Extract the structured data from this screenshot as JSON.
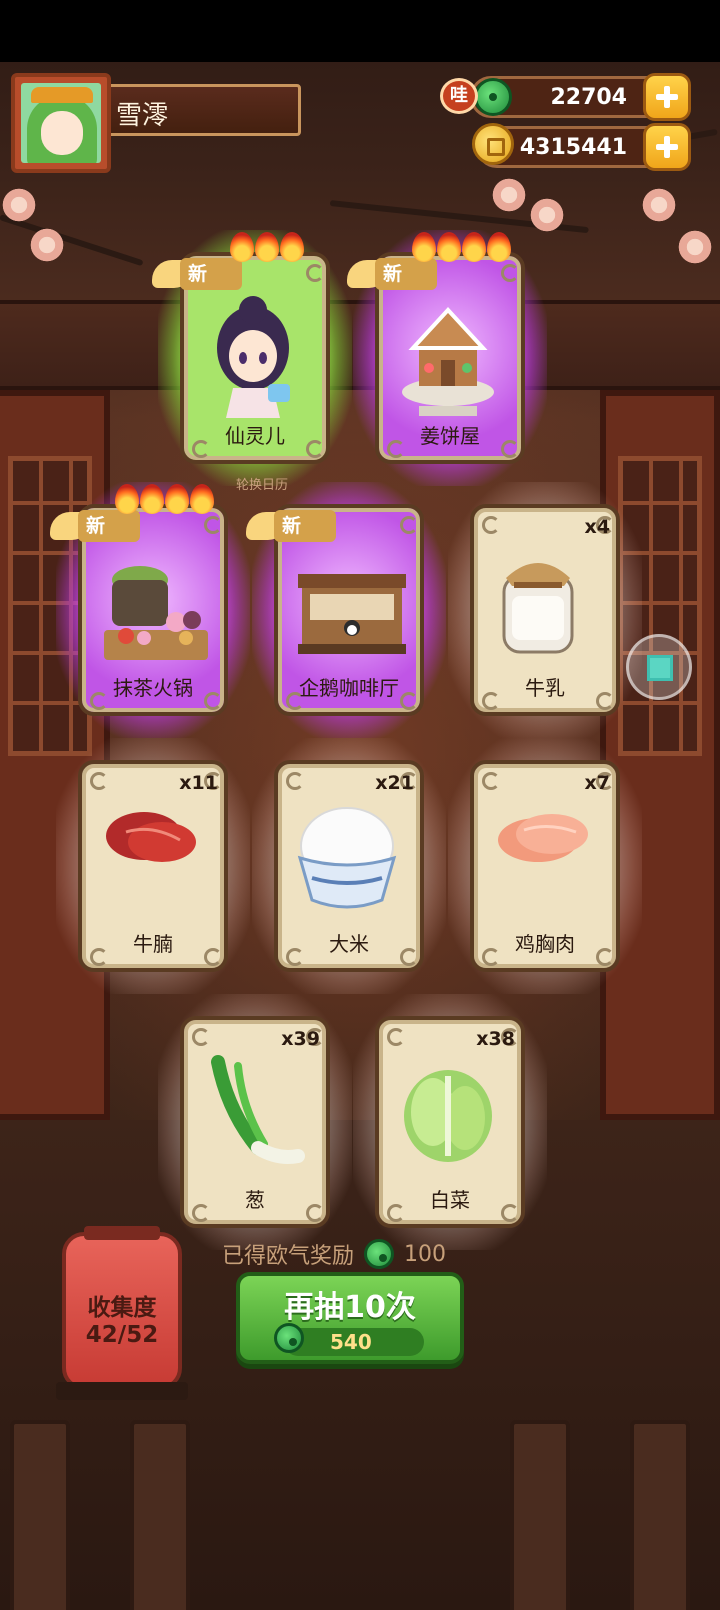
{
  "player": {
    "name": "雪澪"
  },
  "currencies": {
    "jade": "22704",
    "coins": "4315441",
    "badge": "哇"
  },
  "rotate_calendar": "轮换日历",
  "new_tag": "新",
  "cards": [
    {
      "id": "xianlinger",
      "label": "仙灵儿",
      "rarity": "green",
      "is_new": true,
      "flames": 3,
      "count": ""
    },
    {
      "id": "jiangbingwu",
      "label": "姜饼屋",
      "rarity": "purple",
      "is_new": true,
      "flames": 4,
      "count": ""
    },
    {
      "id": "mochahotpot",
      "label": "抹茶火锅",
      "rarity": "purple",
      "is_new": true,
      "flames": 4,
      "count": ""
    },
    {
      "id": "penguincafe",
      "label": "企鹅咖啡厅",
      "rarity": "purple",
      "is_new": true,
      "flames": 0,
      "count": ""
    },
    {
      "id": "milk",
      "label": "牛乳",
      "rarity": "white",
      "is_new": false,
      "flames": 0,
      "count": "x4"
    },
    {
      "id": "beefbrisket",
      "label": "牛腩",
      "rarity": "white",
      "is_new": false,
      "flames": 0,
      "count": "x11"
    },
    {
      "id": "rice",
      "label": "大米",
      "rarity": "white",
      "is_new": false,
      "flames": 0,
      "count": "x21"
    },
    {
      "id": "chickenbreast",
      "label": "鸡胸肉",
      "rarity": "white",
      "is_new": false,
      "flames": 0,
      "count": "x7"
    },
    {
      "id": "scallion",
      "label": "葱",
      "rarity": "white",
      "is_new": false,
      "flames": 0,
      "count": "x39"
    },
    {
      "id": "cabbage",
      "label": "白菜",
      "rarity": "white",
      "is_new": false,
      "flames": 0,
      "count": "x38"
    }
  ],
  "reward": {
    "label": "已得欧气奖励",
    "value": "100"
  },
  "draw_button": {
    "label": "再抽10次",
    "cost": "540"
  },
  "collection": {
    "label": "收集度",
    "progress": "42/52"
  },
  "colors": {
    "green_glow": "#a8e46a",
    "purple_glow": "#c055e6",
    "card_bg": "#efe2c2"
  }
}
